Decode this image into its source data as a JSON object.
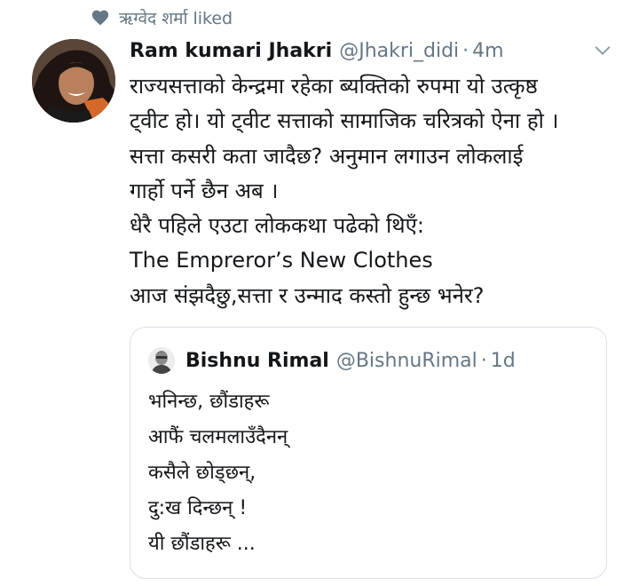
{
  "social_context": {
    "icon": "heart-icon",
    "text": "ऋग्वेद शर्मा liked"
  },
  "tweet": {
    "display_name": "Ram kumari Jhakri",
    "handle": "@Jhakri_didi",
    "separator": "·",
    "time": "4m",
    "lines": [
      "राज्यसत्ताको केन्द्रमा रहेका ब्यक्तिको रुपमा यो उत्कृष्ठ",
      "ट्वीट हो। यो ट्वीट सत्ताको सामाजिक चरित्रको ऐना हो ।",
      "सत्ता कसरी कता जादैछ? अनुमान लगाउन लोकलाई",
      "गार्हो पर्ने छैन अब ।",
      "धेरै पहिले एउटा लोककथा पढेको थिएँ:",
      "The Emprerorʼs New Clothes",
      "आज संझदैछु,सत्ता र उन्माद कस्तो हुन्छ भनेर?"
    ]
  },
  "quoted_tweet": {
    "display_name": "Bishnu Rimal",
    "handle": "@BishnuRimal",
    "separator": "·",
    "time": "1d",
    "lines": [
      "भनिन्छ, छौंडाहरू",
      "आफैं चलमलाउँदैनन्",
      "कसैले छोड्छन्,",
      "दु:ख दिन्छन् !",
      "यी छौंडाहरू ..."
    ]
  },
  "colors": {
    "primary_text": "#14171a",
    "secondary_text": "#657786",
    "border": "#d9e1e8"
  }
}
